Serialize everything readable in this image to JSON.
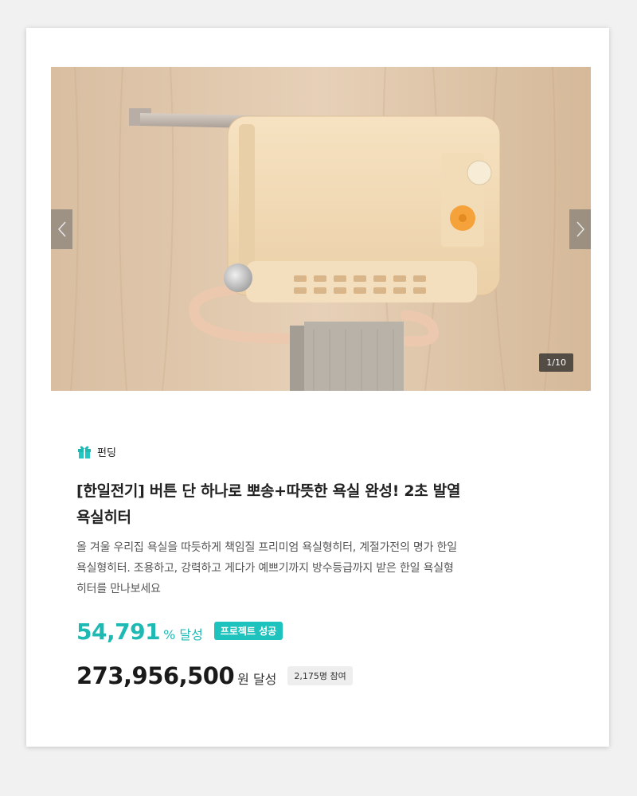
{
  "hero": {
    "counter": "1/10",
    "image_alt": "욕실히터 제품 이미지"
  },
  "category": {
    "label": "펀딩",
    "icon": "gift-icon",
    "icon_color": "#1fb9b4"
  },
  "product": {
    "title_line1": "[한일전기] 버튼 단 하나로 뽀송+따뜻한 욕실 완성! 2초 발열",
    "title_line2": "욕실히터",
    "description_line1": "올 겨울 우리집 욕실을 따듯하게 책임질 프리미엄 욕실형히터, 계절가전의 명가 한일",
    "description_line2": "욕실형히터. 조용하고, 강력하고 게다가 예쁘기까지 방수등급까지 받은 한일 욕실형",
    "description_line3": "히터를 만나보세요"
  },
  "funding": {
    "rate": "54,791",
    "rate_unit": "% 달성",
    "status_badge": "프로젝트 성공",
    "amount": "273,956,500",
    "amount_unit": "원 달성",
    "supporters": "2,175명 참여"
  },
  "colors": {
    "accent": "#1fb9b4",
    "badge": "#1fc3bd"
  }
}
